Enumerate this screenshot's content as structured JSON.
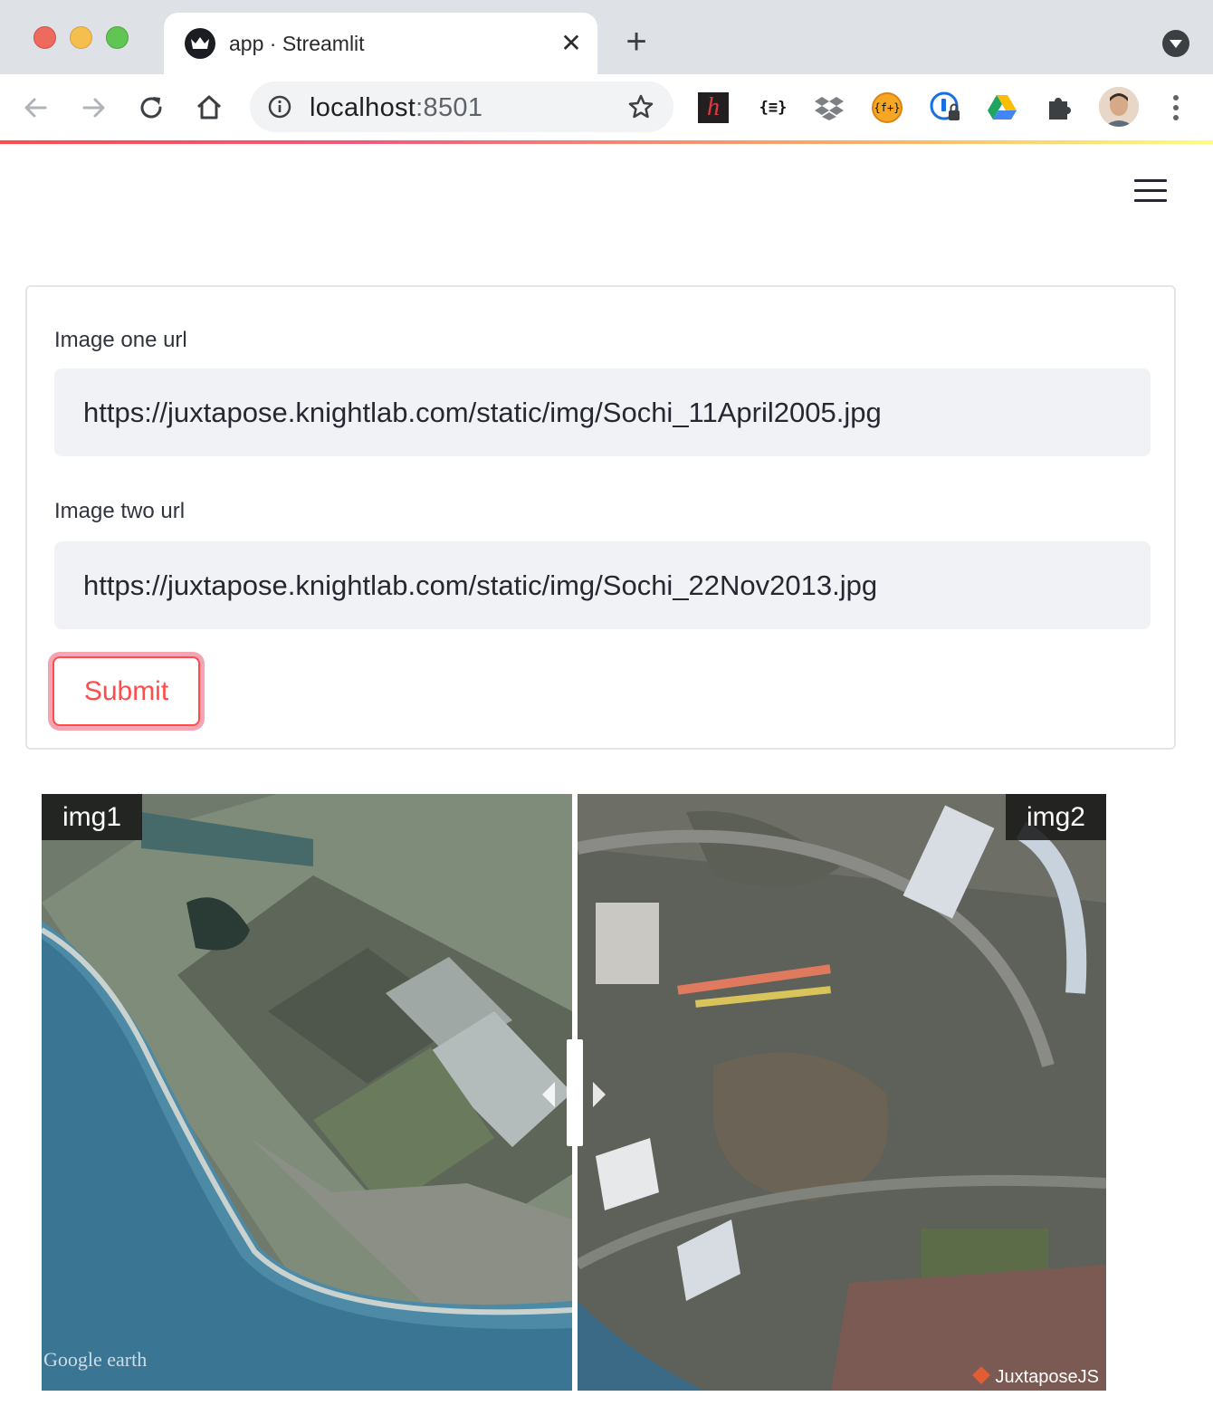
{
  "browser": {
    "tab_title": "app · Streamlit",
    "url_host": "localhost",
    "url_port": ":8501",
    "colors": {
      "tab_strip": "#dee1e6",
      "accent_gradient_start": "#ff4b4b",
      "accent_gradient_end": "#fffd80"
    },
    "extensions": [
      {
        "name": "hypothesis-icon",
        "glyph": "h"
      },
      {
        "name": "json-formatter-icon",
        "glyph": "{≡}"
      },
      {
        "name": "dropbox-icon"
      },
      {
        "name": "fplus-icon",
        "glyph": "{f+}"
      },
      {
        "name": "onepassword-icon"
      },
      {
        "name": "google-drive-icon"
      },
      {
        "name": "extensions-puzzle-icon"
      }
    ]
  },
  "form": {
    "image_one_label": "Image one url",
    "image_one_value": "https://juxtapose.knightlab.com/static/img/Sochi_11April2005.jpg",
    "image_two_label": "Image two url",
    "image_two_value": "https://juxtapose.knightlab.com/static/img/Sochi_22Nov2013.jpg",
    "submit_label": "Submit",
    "accent_color": "#ff4b4b"
  },
  "juxtapose": {
    "left_label": "img1",
    "right_label": "img2",
    "left_watermark": "Google earth",
    "credit": "JuxtaposeJS",
    "slider_position": 0.5
  }
}
